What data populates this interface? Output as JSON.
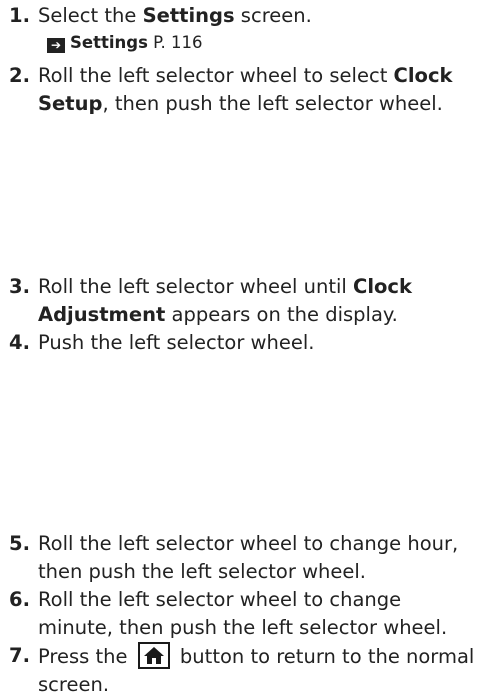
{
  "steps": [
    {
      "num": "1.",
      "pre": "Select the ",
      "bold": "Settings",
      "post": " screen."
    },
    {
      "num": "2.",
      "pre": "Roll the left selector wheel to select ",
      "bold": "Clock Setup",
      "post": ", then push the left selector wheel."
    },
    {
      "num": "3.",
      "pre": "Roll the left selector wheel until ",
      "bold": "Clock Adjustment",
      "post": " appears on the display."
    },
    {
      "num": "4.",
      "text": "Push the left selector wheel."
    },
    {
      "num": "5.",
      "text": "Roll the left selector wheel to change hour, then push the left selector wheel."
    },
    {
      "num": "6.",
      "text": "Roll the left selector wheel to change minute, then push the left selector wheel."
    },
    {
      "num": "7.",
      "pre": "Press the ",
      "icon": "home-icon",
      "post": " button to return to the normal screen."
    }
  ],
  "ref": {
    "label": "Settings",
    "page": "P. 116"
  }
}
